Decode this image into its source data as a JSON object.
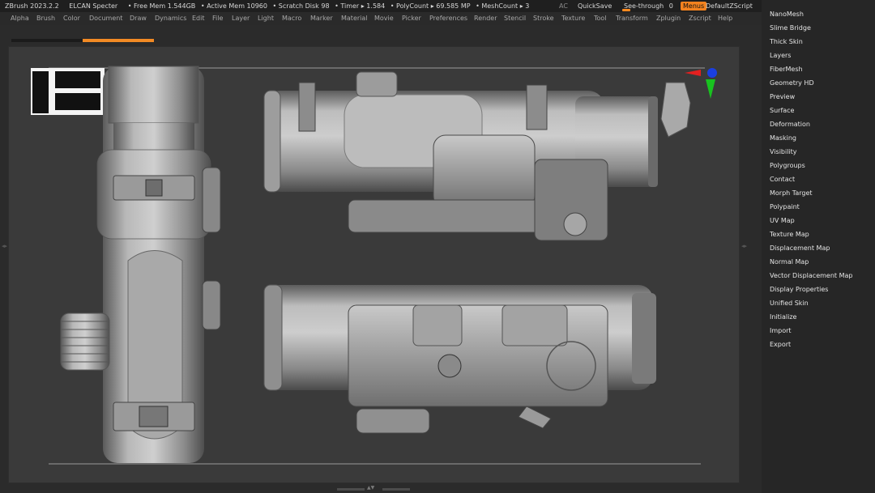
{
  "title_bar": {
    "app": "ZBrush 2023.2.2",
    "doc": "ELCAN Specter",
    "free_mem": "• Free Mem 1.544GB",
    "active_mem": "• Active Mem 10960",
    "scratch": "• Scratch Disk 98",
    "timer": "• Timer ▸ 1.584",
    "polycount": "• PolyCount ▸ 69.585 MP",
    "meshcount": "• MeshCount ▸ 3",
    "ac": "AC",
    "quicksave": "QuickSave",
    "see_through_label": "See-through",
    "see_through_value": "0",
    "menus": "Menus",
    "default_script": "DefaultZScript"
  },
  "menu_bar": [
    "Alpha",
    "Brush",
    "Color",
    "Document",
    "Draw",
    "Dynamics",
    "Edit",
    "File",
    "Layer",
    "Light",
    "Macro",
    "Marker",
    "Material",
    "Movie",
    "Picker",
    "Preferences",
    "Render",
    "Stencil",
    "Stroke",
    "Texture",
    "Tool",
    "Transform",
    "Zplugin",
    "Zscript",
    "Help"
  ],
  "right_panel": {
    "items": [
      "NanoMesh",
      "Slime Bridge",
      "Thick Skin",
      "Layers",
      "FiberMesh",
      "Geometry HD",
      "Preview",
      "Surface",
      "Deformation",
      "Masking",
      "Visibility",
      "Polygroups",
      "Contact",
      "Morph Target",
      "Polypaint",
      "UV Map",
      "Texture Map",
      "Displacement Map",
      "Normal Map",
      "Vector Displacement Map",
      "Display Properties",
      "Unified Skin",
      "Initialize",
      "Import",
      "Export"
    ]
  },
  "colors": {
    "accent": "#f28a24",
    "axis_x": "#e32020",
    "axis_y": "#18c21f",
    "axis_z": "#1a3fe0"
  },
  "icons": {
    "window_controls": [
      "help-icon",
      "minimize-icon",
      "restore-icon",
      "maximize-icon",
      "close-icon"
    ]
  }
}
